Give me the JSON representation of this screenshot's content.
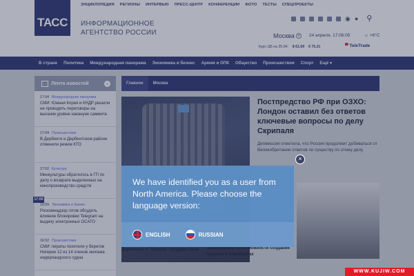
{
  "header": {
    "logo": "ТАСС",
    "agency_line1": "ИНФОРМАЦИОННОЕ",
    "agency_line2": "АГЕНТСТВО РОССИИ",
    "topnav": [
      "ЭНЦИКЛОПЕДИЯ",
      "РЕГИОНЫ",
      "ИНТЕРВЬЮ",
      "ПРЕСС-ЦЕНТР",
      "КОНФЕРЕНЦИИ",
      "ФОТО",
      "ТЕСТЫ",
      "СПЕЦПРОЕКТЫ"
    ],
    "city": "Москва",
    "datetime": "24 апреля, 17:06:05",
    "weather": "+6°C",
    "rates_label": "Курс ЦБ на 25.04:",
    "usd": "$ 61.69",
    "eur": "€ 75.21",
    "partner_a": "Tele",
    "partner_b": "Trade"
  },
  "nav": {
    "items": [
      "В стране",
      "Политика",
      "Международная панорама",
      "Экономика и бизнес",
      "Армия и ОПК",
      "Общество",
      "Происшествия",
      "Спорт"
    ],
    "more": "Ещё"
  },
  "sidebar": {
    "title": "Лента новостей",
    "items": [
      {
        "time": "17:04",
        "category": "Международная панорама",
        "text": "СМИ: Южная Корея и КНДР решили не проводить переговоры на высшем уровне накануне саммита"
      },
      {
        "time": "17:04",
        "category": "Происшествия",
        "text": "В Дербенте и Дербентском районе отменили режим КТО"
      },
      {
        "time": "17:02",
        "category": "Культура",
        "text": "Минкультуры обратилось в ГП по делу о возврате выделенных на кинопроизводство средств"
      },
      {
        "time": "16:59",
        "category": "Экономика и бизнес",
        "text": "Роскомнадзор готов обсудить влияние блокировки Telegram на выдачу электронных ОСАГО"
      },
      {
        "time": "16:52",
        "category": "Происшествия",
        "text": "СМИ: пираты похитили у берегов Нигерии 12 из 14 членов экипажа нидерландского судна"
      }
    ],
    "time_badge": "17:00"
  },
  "content": {
    "tabs": [
      "Главное",
      "Москва"
    ],
    "headline": "Постпредство РФ при ОЗХО: Лондон оставил без ответов ключевые вопросы по делу Скрипаля",
    "lede": "Дипмиссия отметила, что Россия продолжит добиваться от Великобритании ответов по существу по этому делу",
    "under_left": "Дерипаски в \"Русале\" государством",
    "under_right": "законопроект о возможности создания курилок в аэропортах"
  },
  "modal": {
    "message": "We have identified you as a user from North America. Please choose the language version:",
    "english": "ENGLISH",
    "russian": "RUSSIAN",
    "close": "×"
  },
  "watermark": "WWW.KUJIW.COM"
}
